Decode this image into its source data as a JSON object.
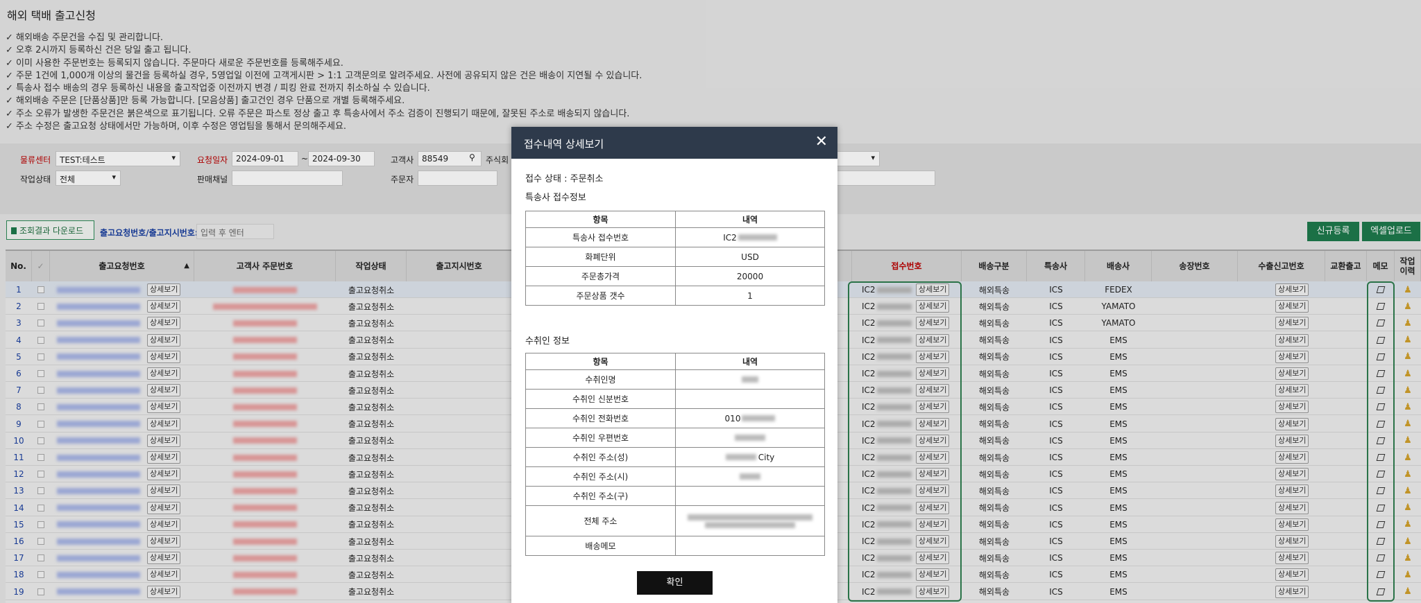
{
  "page_title": "해외 택배 출고신청",
  "notices": [
    "해외배송 주문건을 수집 및 관리합니다.",
    "오후 2시까지 등록하신 건은 당일 출고 됩니다.",
    "이미 사용한 주문번호는 등록되지 않습니다. 주문마다 새로운 주문번호를 등록해주세요.",
    "주문 1건에 1,000개 이상의 물건을 등록하실 경우, 5영업일 이전에 고객게시판 > 1:1 고객문의로 알려주세요. 사전에 공유되지 않은 건은 배송이 지연될 수 있습니다.",
    "특송사 접수 배송의 경우 등록하신 내용을 출고작업중 이전까지 변경 / 피킹 완료 전까지 취소하실 수 있습니다.",
    "해외배송 주문은 [단품상품]만 등록 가능합니다. [모음상품] 출고건인 경우 단품으로 개별 등록해주세요.",
    "주소 오류가 발생한 주문건은 붉은색으로 표기됩니다. 오류 주문은 파스토 정상 출고 후 특송사에서 주소 검증이 진행되기 때문에, 잘못된 주소로 배송되지 않습니다.",
    "주소 수정은 출고요청 상태에서만 가능하며, 이후 수정은 영업팀을 통해서 문의해주세요."
  ],
  "filters": {
    "center_label": "물류센터",
    "center_value": "TEST:테스트",
    "date_label": "요청일자",
    "date_from": "2024-09-01",
    "date_sep": "~",
    "date_to": "2024-09-30",
    "customer_label": "고객사",
    "customer_value": "88549",
    "customer_name": "주식회",
    "status_label": "작업상태",
    "status_value": "전체",
    "channel_label": "판매채널",
    "orderer_label": "주문자"
  },
  "actions": {
    "download": "조회결과 다운로드",
    "search_label": "출고요청번호/출고지시번호:",
    "search_placeholder": "입력 후 엔터",
    "new_button": "신규등록",
    "excel_button": "엑셀업로드"
  },
  "grid": {
    "headers": {
      "no": "No.",
      "request_no": "출고요청번호",
      "customer_order": "고객사 주문번호",
      "status": "작업상태",
      "instruction_no": "출고지시번호",
      "receipt_no": "접수번호",
      "ship_type": "배송구분",
      "carrier": "특송사",
      "deliverer": "배송사",
      "invoice_no": "송장번호",
      "export_no": "수출신고번호",
      "exchange": "교환출고",
      "memo": "메모",
      "history": "작업이력"
    },
    "detail_label": "상세보기",
    "receipt_prefix": "IC2",
    "rows": [
      {
        "no": "1",
        "status": "출고요청취소",
        "ship": "해외특송",
        "carrier": "ICS",
        "deliverer": "FEDEX"
      },
      {
        "no": "2",
        "status": "출고요청취소",
        "ship": "해외특송",
        "carrier": "ICS",
        "deliverer": "YAMATO"
      },
      {
        "no": "3",
        "status": "출고요청취소",
        "ship": "해외특송",
        "carrier": "ICS",
        "deliverer": "YAMATO"
      },
      {
        "no": "4",
        "status": "출고요청취소",
        "ship": "해외특송",
        "carrier": "ICS",
        "deliverer": "EMS"
      },
      {
        "no": "5",
        "status": "출고요청취소",
        "ship": "해외특송",
        "carrier": "ICS",
        "deliverer": "EMS"
      },
      {
        "no": "6",
        "status": "출고요청취소",
        "ship": "해외특송",
        "carrier": "ICS",
        "deliverer": "EMS"
      },
      {
        "no": "7",
        "status": "출고요청취소",
        "ship": "해외특송",
        "carrier": "ICS",
        "deliverer": "EMS"
      },
      {
        "no": "8",
        "status": "출고요청취소",
        "ship": "해외특송",
        "carrier": "ICS",
        "deliverer": "EMS"
      },
      {
        "no": "9",
        "status": "출고요청취소",
        "ship": "해외특송",
        "carrier": "ICS",
        "deliverer": "EMS"
      },
      {
        "no": "10",
        "status": "출고요청취소",
        "ship": "해외특송",
        "carrier": "ICS",
        "deliverer": "EMS"
      },
      {
        "no": "11",
        "status": "출고요청취소",
        "ship": "해외특송",
        "carrier": "ICS",
        "deliverer": "EMS"
      },
      {
        "no": "12",
        "status": "출고요청취소",
        "ship": "해외특송",
        "carrier": "ICS",
        "deliverer": "EMS"
      },
      {
        "no": "13",
        "status": "출고요청취소",
        "ship": "해외특송",
        "carrier": "ICS",
        "deliverer": "EMS"
      },
      {
        "no": "14",
        "status": "출고요청취소",
        "ship": "해외특송",
        "carrier": "ICS",
        "deliverer": "EMS"
      },
      {
        "no": "15",
        "status": "출고요청취소",
        "ship": "해외특송",
        "carrier": "ICS",
        "deliverer": "EMS"
      },
      {
        "no": "16",
        "status": "출고요청취소",
        "ship": "해외특송",
        "carrier": "ICS",
        "deliverer": "EMS"
      },
      {
        "no": "17",
        "status": "출고요청취소",
        "ship": "해외특송",
        "carrier": "ICS",
        "deliverer": "EMS"
      },
      {
        "no": "18",
        "status": "출고요청취소",
        "ship": "해외특송",
        "carrier": "ICS",
        "deliverer": "EMS"
      },
      {
        "no": "19",
        "status": "출고요청취소",
        "ship": "해외특송",
        "carrier": "ICS",
        "deliverer": "EMS"
      }
    ]
  },
  "modal": {
    "title": "접수내역 상세보기",
    "status_line": "접수 상태 : 주문취소",
    "carrier_section": "특송사 접수정보",
    "col_item": "항목",
    "col_detail": "내역",
    "carrier_rows": [
      {
        "label": "특송사 접수번호",
        "value": "IC2"
      },
      {
        "label": "화폐단위",
        "value": "USD"
      },
      {
        "label": "주문총가격",
        "value": "20000"
      },
      {
        "label": "주문상품 갯수",
        "value": "1"
      }
    ],
    "recipient_section": "수취인 정보",
    "recipient_rows": [
      {
        "label": "수취인명",
        "value": ""
      },
      {
        "label": "수취인 신분번호",
        "value": ""
      },
      {
        "label": "수취인 전화번호",
        "value": "010"
      },
      {
        "label": "수취인 우편번호",
        "value": ""
      },
      {
        "label": "수취인 주소(성)",
        "value": "City"
      },
      {
        "label": "수취인 주소(시)",
        "value": ""
      },
      {
        "label": "수취인 주소(구)",
        "value": ""
      },
      {
        "label": "전체 주소",
        "value": ""
      },
      {
        "label": "배송메모",
        "value": ""
      }
    ],
    "confirm": "확인"
  }
}
